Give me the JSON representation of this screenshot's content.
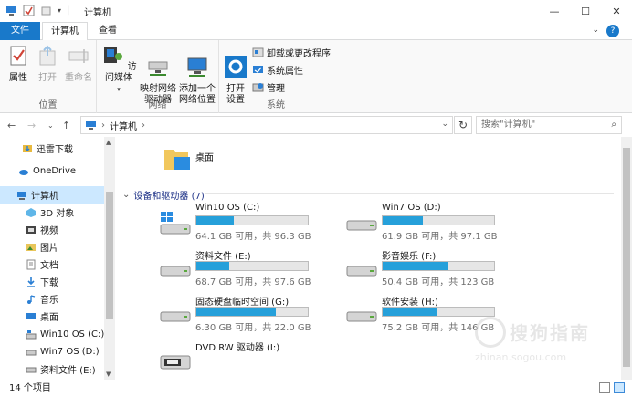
{
  "window": {
    "title": "计算机"
  },
  "tabs": [
    {
      "label": "文件"
    },
    {
      "label": "计算机"
    },
    {
      "label": "查看"
    }
  ],
  "ribbon": {
    "groups": [
      {
        "label": "位置",
        "buttons": [
          {
            "label": "属性"
          },
          {
            "label": "打开"
          },
          {
            "label": "重命名"
          }
        ]
      },
      {
        "label": "网络",
        "buttons": [
          {
            "label": "访问媒体"
          },
          {
            "label": "映射网络\n驱动器"
          },
          {
            "label": "添加一个\n网络位置"
          }
        ]
      },
      {
        "label": "系统",
        "buttons": [
          {
            "label": "打开\n设置"
          }
        ],
        "small": [
          {
            "label": "卸载或更改程序"
          },
          {
            "label": "系统属性"
          },
          {
            "label": "管理"
          }
        ]
      }
    ]
  },
  "address": {
    "path": "计算机",
    "search_placeholder": "搜索\"计算机\""
  },
  "nav": {
    "items": [
      {
        "label": "迅雷下载"
      },
      {
        "label": "OneDrive"
      },
      {
        "label": "计算机"
      },
      {
        "label": "3D 对象"
      },
      {
        "label": "视频"
      },
      {
        "label": "图片"
      },
      {
        "label": "文档"
      },
      {
        "label": "下载"
      },
      {
        "label": "音乐"
      },
      {
        "label": "桌面"
      },
      {
        "label": "Win10 OS (C:)"
      },
      {
        "label": "Win7 OS (D:)"
      },
      {
        "label": "资料文件 (E:)"
      }
    ]
  },
  "content": {
    "folder_label": "桌面",
    "section_title": "设备和驱动器 (7)",
    "drives": [
      {
        "name": "Win10 OS (C:)",
        "info": "64.1 GB 可用，共 96.3 GB",
        "used": 0.334,
        "os": true
      },
      {
        "name": "Win7 OS (D:)",
        "info": "61.9 GB 可用，共 97.1 GB",
        "used": 0.362
      },
      {
        "name": "资料文件 (E:)",
        "info": "68.7 GB 可用，共 97.6 GB",
        "used": 0.296
      },
      {
        "name": "影音娱乐 (F:)",
        "info": "50.4 GB 可用，共 123 GB",
        "used": 0.59
      },
      {
        "name": "固态硬盘临时空间 (G:)",
        "info": "6.30 GB 可用，共 22.0 GB",
        "used": 0.714
      },
      {
        "name": "软件安装 (H:)",
        "info": "75.2 GB 可用，共 146 GB",
        "used": 0.485
      },
      {
        "name": "DVD RW 驱动器 (I:)",
        "info": "",
        "dvd": true
      }
    ]
  },
  "status": {
    "count": "14 个项目"
  },
  "watermark": {
    "text": "搜狗指南",
    "url": "zhinan.sogou.com"
  },
  "colors": {
    "accent": "#1979ca",
    "bar_fill": "#26a0da",
    "selection": "#cce8ff"
  }
}
